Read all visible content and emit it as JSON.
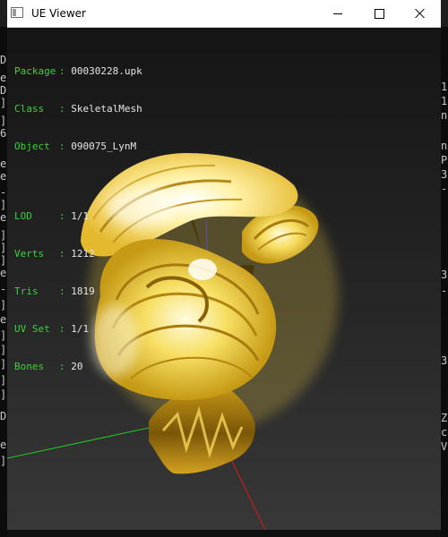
{
  "window": {
    "title": "UE Viewer"
  },
  "info": {
    "asset": [
      {
        "key": "Package",
        "value": "00030228.upk"
      },
      {
        "key": "Class",
        "value": "SkeletalMesh"
      },
      {
        "key": "Object",
        "value": "090075_LynM"
      }
    ],
    "stats": [
      {
        "key": "LOD",
        "value": "1/1"
      },
      {
        "key": "Verts",
        "value": "1212"
      },
      {
        "key": "Tris",
        "value": "1819"
      },
      {
        "key": "UV Set",
        "value": "1/1"
      },
      {
        "key": "Bones",
        "value": "20"
      }
    ]
  },
  "background_console": {
    "left": [
      "D",
      "e",
      "D",
      "]",
      "]",
      "6",
      "e",
      "e",
      "-",
      "]",
      "e",
      "]",
      "]",
      "]",
      "e",
      "-",
      "]",
      "e",
      "]",
      "]",
      "]",
      "]",
      "]",
      "D",
      "e",
      "]"
    ],
    "right": [
      "1",
      "1",
      "n",
      "n",
      "P",
      "3",
      "-",
      "3",
      "-",
      "3",
      "Z",
      "c",
      "V"
    ]
  },
  "colors": {
    "label_green": "#3ed13e",
    "value_white": "#e6e6e6",
    "mesh_gold": "#f2d24a",
    "axis_x": "#d81818",
    "axis_y": "#22c922",
    "axis_z": "#2a2ad8"
  }
}
